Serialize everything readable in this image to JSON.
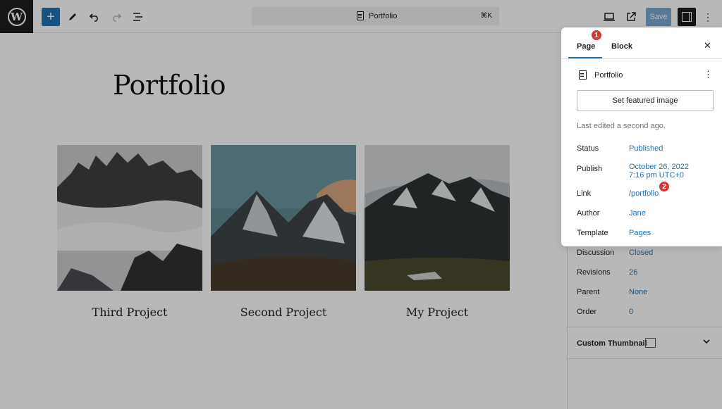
{
  "toolbar": {
    "logo": "W",
    "add_icon": "+",
    "tools_icon": "pencil-icon",
    "undo_icon": "undo-icon",
    "redo_icon": "redo-icon",
    "list_view_icon": "list-view-icon",
    "command_title": "Portfolio",
    "command_shortcut": "⌘K",
    "view_icon": "desktop-icon",
    "preview_icon": "external-link-icon",
    "save_label": "Save",
    "more": "⋮"
  },
  "canvas": {
    "page_title": "Portfolio",
    "cards": [
      {
        "caption": "Third Project"
      },
      {
        "caption": "Second Project"
      },
      {
        "caption": "My Project"
      }
    ]
  },
  "panel": {
    "tabs": [
      "Page",
      "Block"
    ],
    "close": "✕",
    "page_name": "Portfolio",
    "kebab": "⋮",
    "featured_image_button": "Set featured image",
    "last_edited": "Last edited a second ago.",
    "fields": [
      {
        "label": "Status",
        "value": "Published"
      },
      {
        "label": "Publish",
        "value": "October 26, 2022",
        "value2": "7:16 pm UTC+0"
      },
      {
        "label": "Link",
        "value": "/portfolio"
      },
      {
        "label": "Author",
        "value": "Jane"
      },
      {
        "label": "Template",
        "value": "Pages"
      }
    ],
    "badges": [
      "1",
      "2"
    ]
  },
  "sidebar": {
    "fields": [
      {
        "label": "Discussion",
        "value": "Closed"
      },
      {
        "label": "Revisions",
        "value": "26"
      },
      {
        "label": "Parent",
        "value": "None"
      },
      {
        "label": "Order",
        "value": "0"
      }
    ],
    "custom_thumbnail": "Custom Thumbnail",
    "chevron": "⌄"
  },
  "colors": {
    "accent": "#2271b1",
    "badge": "#d63638",
    "dark": "#1e1e1e"
  }
}
